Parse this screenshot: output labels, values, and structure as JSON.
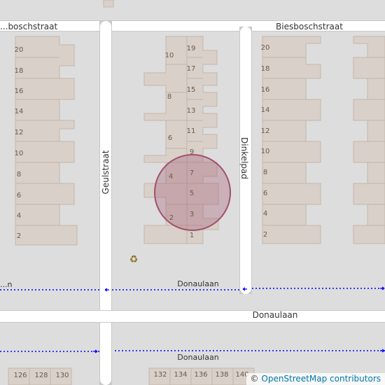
{
  "map": {
    "streets": {
      "biesbosch_west": "...boschstraat",
      "biesbosch_east": "Biesboschstraat",
      "geulstraat": "Geulstraat",
      "dinkelpad": "Dinkelpad",
      "donaulaan_path_west": "...n",
      "donaulaan_path_mid": "Donaulaan",
      "donaulaan_main": "Donaulaan",
      "donaulaan_south_path": "Donaulaan"
    },
    "house_numbers": {
      "west_block": [
        "20",
        "18",
        "16",
        "14",
        "12",
        "10",
        "8",
        "6",
        "4",
        "2"
      ],
      "middle_block_left": [
        "10",
        "8",
        "6",
        "4",
        "2"
      ],
      "middle_block_right": [
        "19",
        "17",
        "15",
        "13",
        "11",
        "9",
        "7",
        "5",
        "3",
        "1"
      ],
      "east_block": [
        "20",
        "18",
        "16",
        "14",
        "12",
        "10",
        "8",
        "6",
        "4",
        "2"
      ],
      "south_row_left": [
        "126",
        "128",
        "130"
      ],
      "south_row_right": [
        "132",
        "134",
        "136",
        "138",
        "140"
      ]
    },
    "recycling_icon": "recycling-icon",
    "marker_color": "#a0506e",
    "road_color": "#ffffff",
    "building_color": "#d9d0c9",
    "path_color": "#0000ff"
  },
  "attribution": {
    "copyright": "©",
    "credit": "OpenStreetMap contributors"
  }
}
